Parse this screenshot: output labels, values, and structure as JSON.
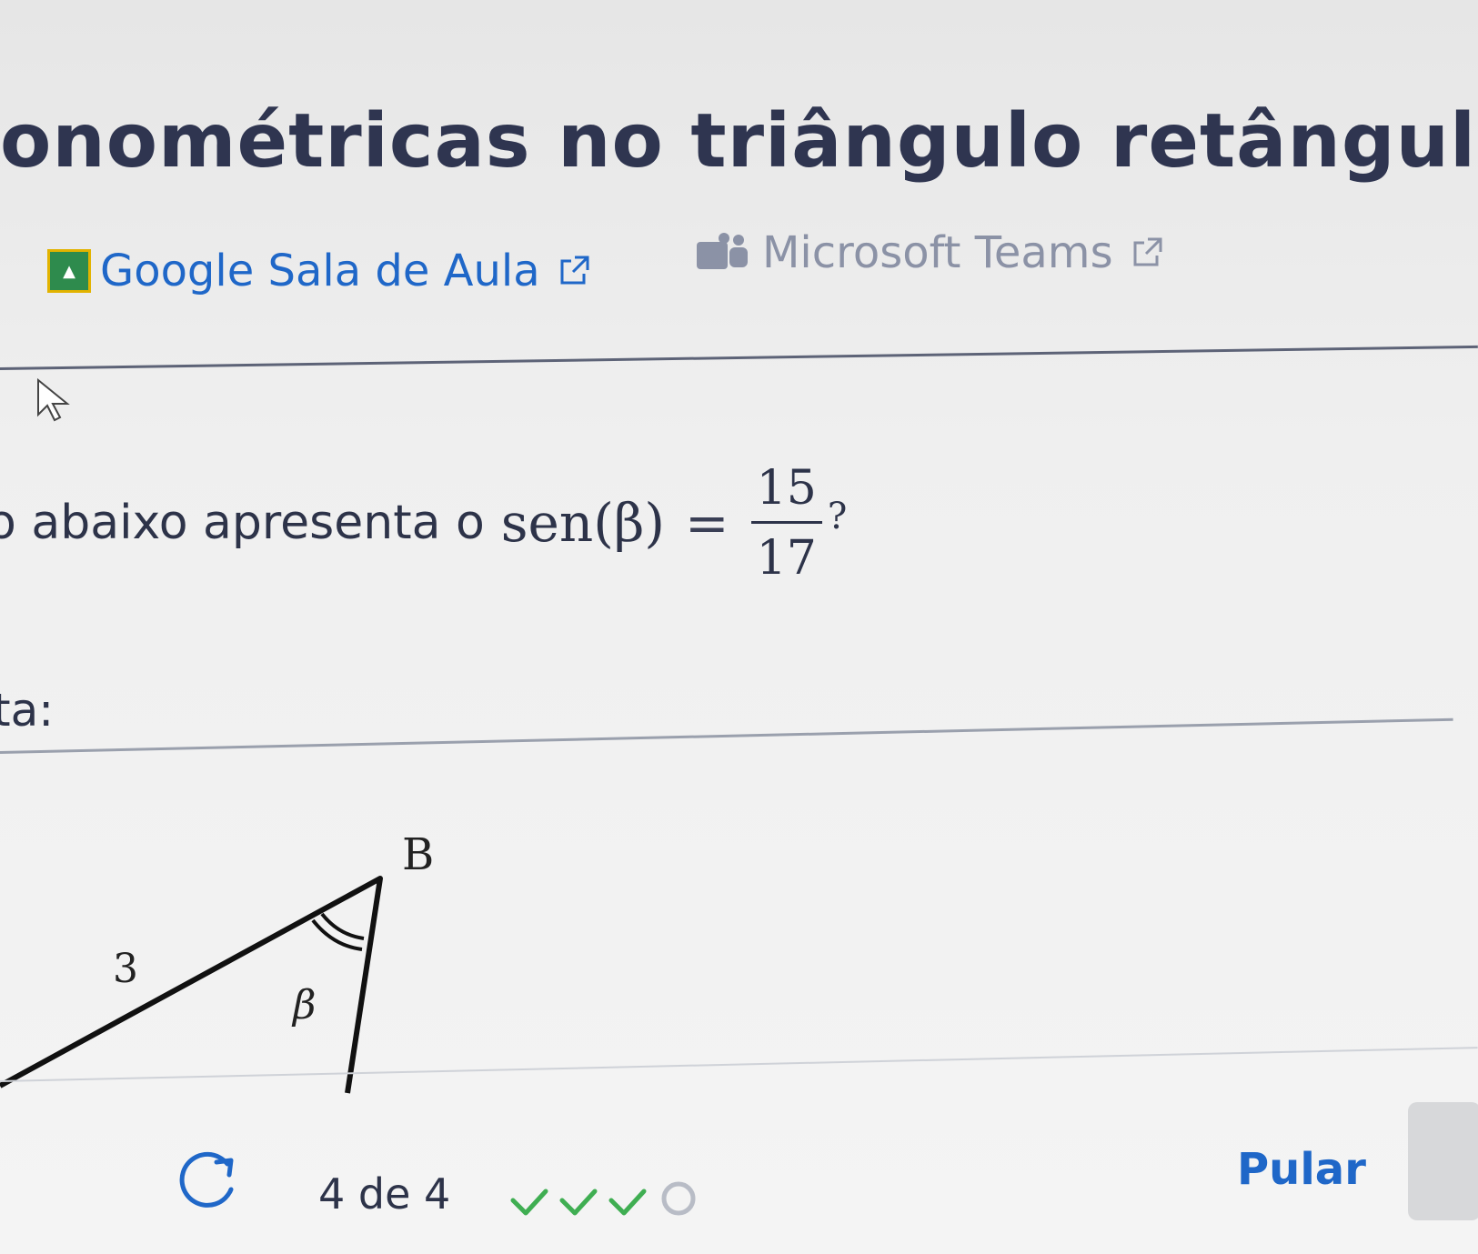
{
  "header": {
    "title": "onométricas no triângulo retângulo: ser"
  },
  "share": {
    "google_label": "Google Sala de Aula",
    "teams_label": "Microsoft Teams"
  },
  "question": {
    "prefix": "o abaixo apresenta o",
    "func": "sen(β)",
    "equals": "=",
    "numerator": "15",
    "denominator": "17",
    "suffix": "?"
  },
  "answer": {
    "label": "ta:"
  },
  "figure": {
    "vertex_label": "B",
    "side_label": "3",
    "angle_label": "β"
  },
  "footer": {
    "progress": "4 de 4",
    "skip_label": "Pular",
    "completed": 3,
    "total": 4
  },
  "colors": {
    "link": "#1f67c8",
    "check": "#3fae52",
    "text": "#2d3349"
  }
}
